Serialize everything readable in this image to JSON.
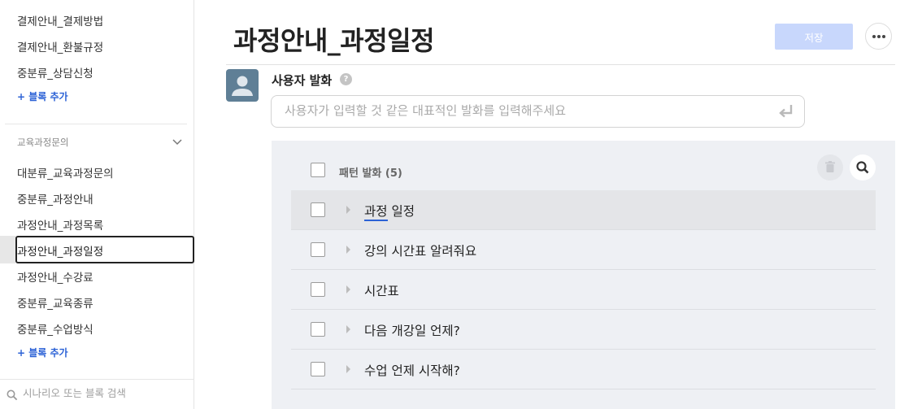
{
  "sidebar": {
    "top_items": [
      {
        "label": "결제안내_결제방법"
      },
      {
        "label": "결제안내_환불규정"
      },
      {
        "label": "중분류_상담신청"
      }
    ],
    "add_block_1": "+ 블록 추가",
    "group_title": "교육과정문의",
    "group_items": [
      {
        "label": "대분류_교육과정문의"
      },
      {
        "label": "중분류_과정안내"
      },
      {
        "label": "과정안내_과정목록"
      },
      {
        "label": "과정안내_과정일정"
      },
      {
        "label": "과정안내_수강료"
      },
      {
        "label": "중분류_교육종류"
      },
      {
        "label": "중분류_수업방식"
      }
    ],
    "add_block_2": "+ 블록 추가",
    "search_placeholder": "시나리오 또는 블록 검색"
  },
  "header": {
    "title": "과정안내_과정일정",
    "save_label": "저장"
  },
  "user_utterance": {
    "title": "사용자 발화",
    "help": "?",
    "input_value": "",
    "input_placeholder": "사용자가 입력할 것 같은 대표적인 발화를 입력해주세요"
  },
  "patterns": {
    "title": "패턴 발화 (5)",
    "items": [
      {
        "text": "과정 일정"
      },
      {
        "text": "강의 시간표 알려줘요"
      },
      {
        "text": "시간표"
      },
      {
        "text": "다음 개강일 언제?"
      },
      {
        "text": "수업 언제 시작해?"
      }
    ]
  },
  "colors": {
    "accent": "#2c62d6",
    "save_button_disabled": "#c8d7fc",
    "panel_background": "#eef0f4",
    "avatar": "#5f7f96"
  },
  "icons": {
    "chevron": "chevron-down-icon",
    "search": "search-icon",
    "help": "help-icon",
    "enter": "enter-icon",
    "trash": "trash-icon",
    "more": "more-icon",
    "expand": "expand-triangle-icon"
  }
}
